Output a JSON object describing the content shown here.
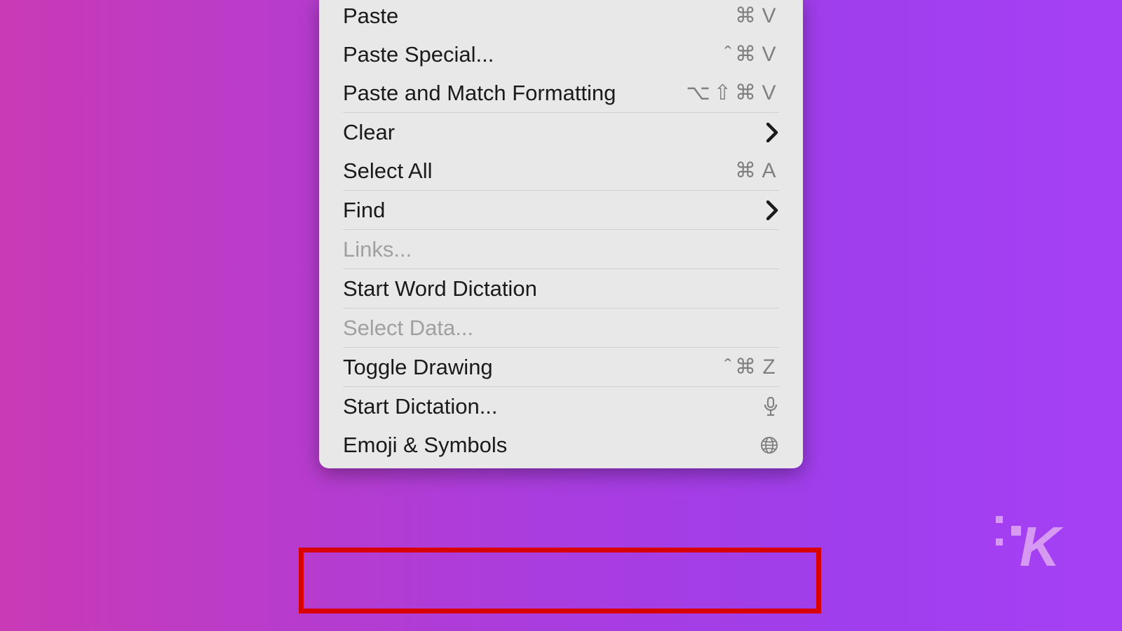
{
  "menu": {
    "items": [
      {
        "label": "Paste",
        "shortcut": "⌘ V",
        "type": "shortcut"
      },
      {
        "label": "Paste Special...",
        "shortcut": "^⌘ V",
        "type": "shortcut"
      },
      {
        "label": "Paste and Match Formatting",
        "shortcut": "⌥⇧⌘ V",
        "type": "shortcut"
      },
      {
        "sep": true
      },
      {
        "label": "Clear",
        "type": "submenu"
      },
      {
        "label": "Select All",
        "shortcut": "⌘ A",
        "type": "shortcut"
      },
      {
        "sep": true
      },
      {
        "label": "Find",
        "type": "submenu"
      },
      {
        "sep": true
      },
      {
        "label": "Links...",
        "disabled": true
      },
      {
        "sep": true
      },
      {
        "label": "Start Word Dictation"
      },
      {
        "sep": true
      },
      {
        "label": "Select Data...",
        "disabled": true
      },
      {
        "sep": true
      },
      {
        "label": "Toggle Drawing",
        "shortcut": "^⌘ Z",
        "type": "shortcut"
      },
      {
        "sep": true
      },
      {
        "label": "Start Dictation...",
        "type": "icon",
        "icon": "mic"
      },
      {
        "label": "Emoji & Symbols",
        "type": "icon",
        "icon": "globe",
        "highlighted": true
      }
    ]
  },
  "highlight_color": "#d80000"
}
